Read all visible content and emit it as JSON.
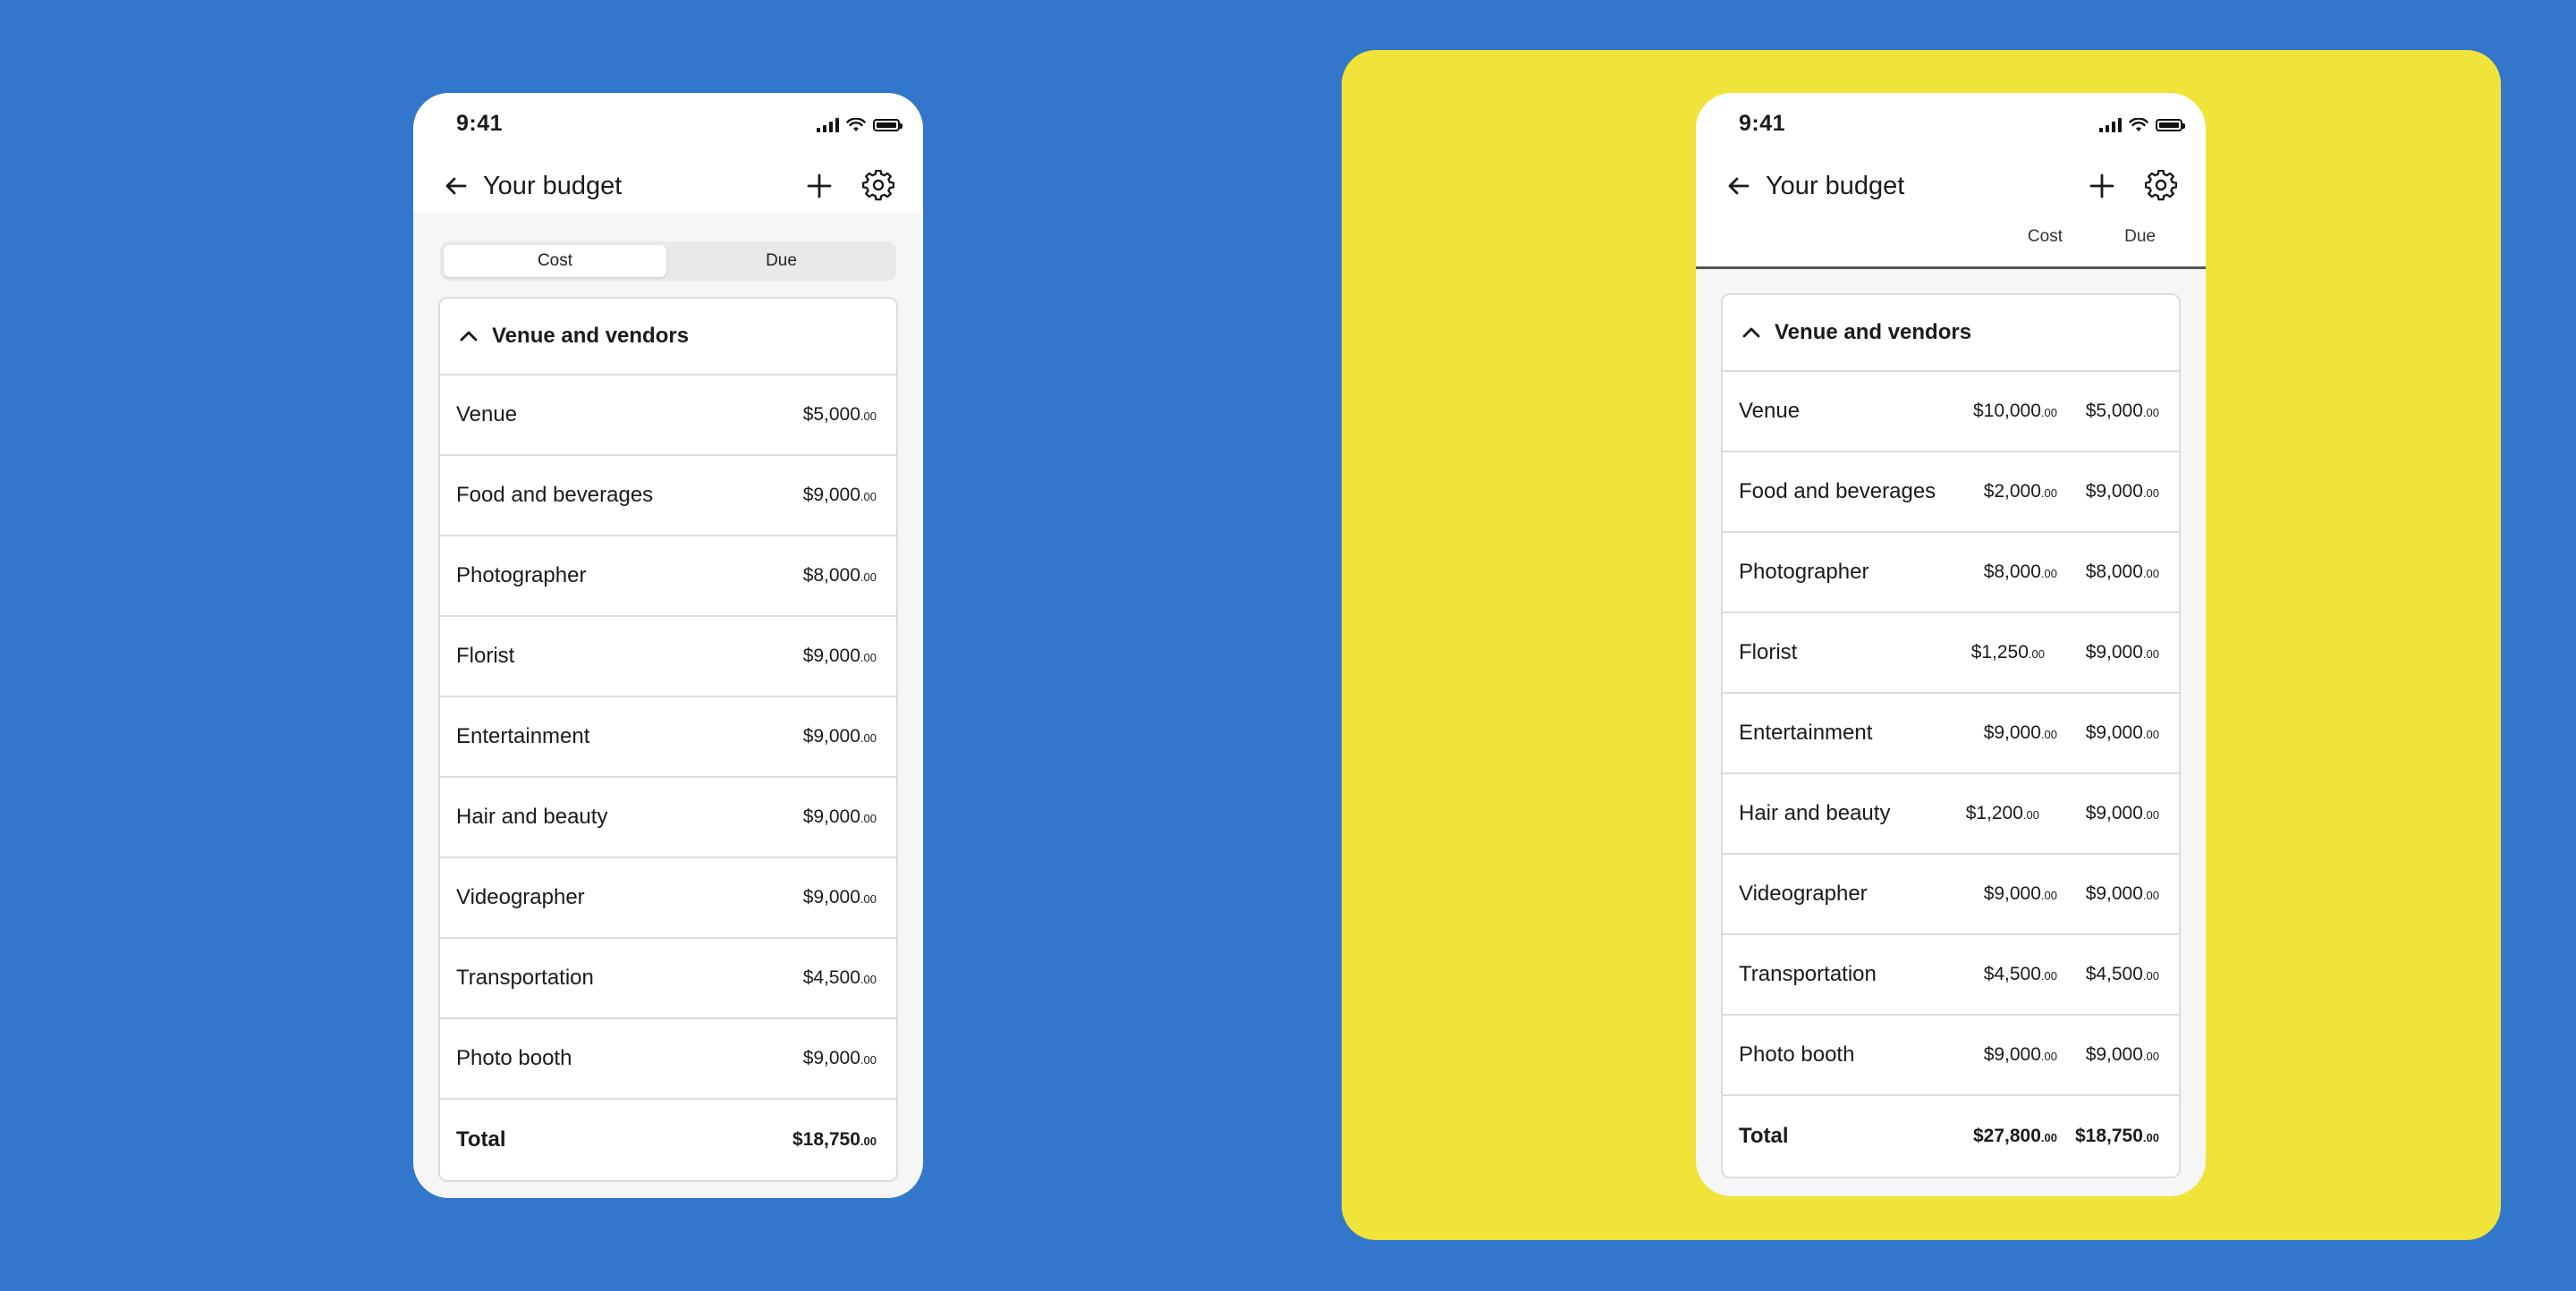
{
  "colors": {
    "background": "#3377cc",
    "highlight_panel": "#f0e33a",
    "card_border": "#dcdce0",
    "text": "#1b1b1f"
  },
  "left_screen": {
    "status": {
      "time": "9:41"
    },
    "header": {
      "title": "Your budget",
      "back_icon": "arrow-left-icon",
      "add_icon": "plus-icon",
      "settings_icon": "gear-icon"
    },
    "segmented_control": {
      "options": [
        "Cost",
        "Due"
      ],
      "selected": "Cost"
    },
    "group": {
      "title": "Venue and vendors",
      "items": [
        {
          "label": "Venue",
          "amount": "$5,000",
          "cents": ".00"
        },
        {
          "label": "Food and beverages",
          "amount": "$9,000",
          "cents": ".00"
        },
        {
          "label": "Photographer",
          "amount": "$8,000",
          "cents": ".00"
        },
        {
          "label": "Florist",
          "amount": "$9,000",
          "cents": ".00"
        },
        {
          "label": "Entertainment",
          "amount": "$9,000",
          "cents": ".00"
        },
        {
          "label": "Hair and beauty",
          "amount": "$9,000",
          "cents": ".00"
        },
        {
          "label": "Videographer",
          "amount": "$9,000",
          "cents": ".00"
        },
        {
          "label": "Transportation",
          "amount": "$4,500",
          "cents": ".00"
        },
        {
          "label": "Photo booth",
          "amount": "$9,000",
          "cents": ".00"
        }
      ],
      "total": {
        "label": "Total",
        "amount": "$18,750",
        "cents": ".00"
      }
    }
  },
  "right_screen": {
    "status": {
      "time": "9:41"
    },
    "header": {
      "title": "Your budget",
      "back_icon": "arrow-left-icon",
      "add_icon": "plus-icon",
      "settings_icon": "gear-icon"
    },
    "columns": {
      "cost": "Cost",
      "due": "Due"
    },
    "group": {
      "title": "Venue and vendors",
      "items": [
        {
          "label": "Venue",
          "cost": "$10,000",
          "cost_cents": ".00",
          "due": "$5,000",
          "due_cents": ".00"
        },
        {
          "label": "Food and beverages",
          "cost": "$2,000",
          "cost_cents": ".00",
          "due": "$9,000",
          "due_cents": ".00"
        },
        {
          "label": "Photographer",
          "cost": "$8,000",
          "cost_cents": ".00",
          "due": "$8,000",
          "due_cents": ".00"
        },
        {
          "label": "Florist",
          "cost": "$1,250",
          "cost_cents": ".00",
          "due": "$9,000",
          "due_cents": ".00"
        },
        {
          "label": "Entertainment",
          "cost": "$9,000",
          "cost_cents": ".00",
          "due": "$9,000",
          "due_cents": ".00"
        },
        {
          "label": "Hair and beauty",
          "cost": "$1,200",
          "cost_cents": ".00",
          "due": "$9,000",
          "due_cents": ".00"
        },
        {
          "label": "Videographer",
          "cost": "$9,000",
          "cost_cents": ".00",
          "due": "$9,000",
          "due_cents": ".00"
        },
        {
          "label": "Transportation",
          "cost": "$4,500",
          "cost_cents": ".00",
          "due": "$4,500",
          "due_cents": ".00"
        },
        {
          "label": "Photo booth",
          "cost": "$9,000",
          "cost_cents": ".00",
          "due": "$9,000",
          "due_cents": ".00"
        }
      ],
      "total": {
        "label": "Total",
        "cost": "$27,800",
        "cost_cents": ".00",
        "due": "$18,750",
        "due_cents": ".00"
      }
    }
  }
}
